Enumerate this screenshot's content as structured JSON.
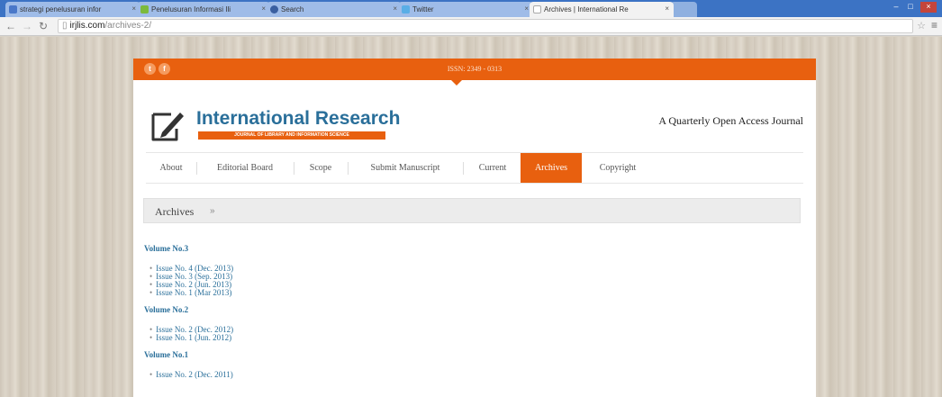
{
  "browser": {
    "tabs": [
      {
        "title": "strategi penelusuran infor"
      },
      {
        "title": "Penelusuran Informasi Ili"
      },
      {
        "title": "Search"
      },
      {
        "title": "Twitter"
      },
      {
        "title": "Archives | International Re"
      }
    ],
    "url_domain": "irjlis.com",
    "url_path": "/archives-2/",
    "window_controls": [
      "–",
      "□",
      "×"
    ]
  },
  "site": {
    "issn": "ISSN: 2349 - 0313",
    "social": [
      "t",
      "f"
    ],
    "logo_title": "International Research",
    "logo_subtitle": "JOURNAL OF LIBRARY AND INFORMATION SCIENCE",
    "tagline": "A Quarterly Open Access Journal",
    "nav": [
      "About",
      "Editorial Board",
      "Scope",
      "Submit Manuscript",
      "Current",
      "Archives",
      "Copyright"
    ],
    "active_nav": "Archives",
    "archives_title": "Archives",
    "archives_arrow": "»"
  },
  "volumes": [
    {
      "title": "Volume No.3",
      "issues": [
        "Issue No. 4 (Dec. 2013)",
        "Issue No. 3 (Sep. 2013)",
        "Issue No. 2 (Jun. 2013)",
        "Issue No. 1 (Mar 2013)"
      ]
    },
    {
      "title": "Volume No.2",
      "issues": [
        "Issue No. 2 (Dec. 2012)",
        "Issue No. 1 (Jun. 2012)"
      ]
    },
    {
      "title": "Volume No.1",
      "issues": [
        "Issue No. 2 (Dec. 2011)"
      ]
    }
  ],
  "colors": {
    "accent": "#e8600f",
    "link": "#2a6f9a",
    "chrome": "#3c73c4"
  }
}
